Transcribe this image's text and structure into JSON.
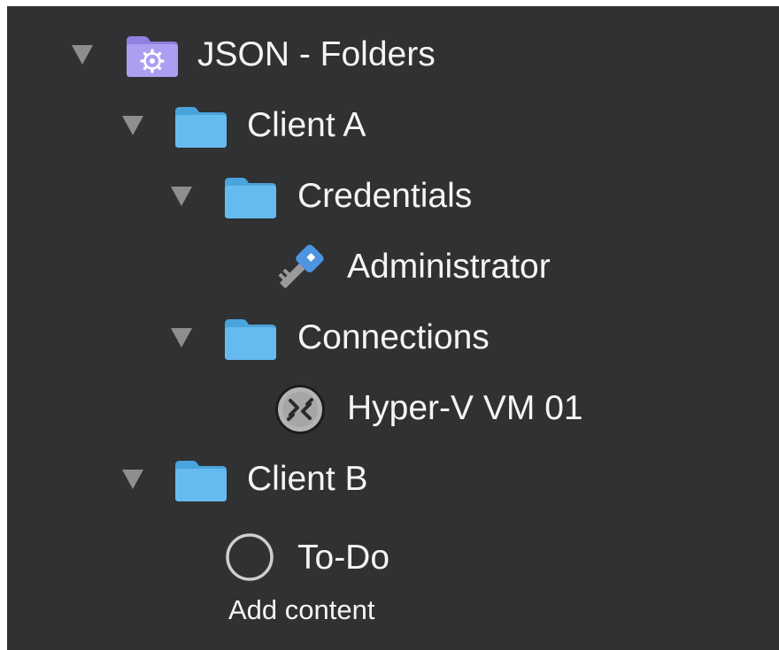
{
  "tree": {
    "root": {
      "label": "JSON - Folders",
      "icon": "gear-folder-icon",
      "expanded": true
    },
    "client_a": {
      "label": "Client A",
      "icon": "folder-icon",
      "expanded": true
    },
    "credentials": {
      "label": "Credentials",
      "icon": "folder-icon",
      "expanded": true
    },
    "administrator": {
      "label": "Administrator",
      "icon": "key-icon"
    },
    "connections": {
      "label": "Connections",
      "icon": "folder-icon",
      "expanded": true
    },
    "hyperv": {
      "label": "Hyper-V VM 01",
      "icon": "remote-desktop-icon"
    },
    "client_b": {
      "label": "Client B",
      "icon": "folder-icon",
      "expanded": true
    },
    "todo": {
      "label": "To-Do",
      "icon": "circle-checkbox-icon"
    }
  },
  "footer": {
    "add_content_label": "Add content"
  },
  "colors": {
    "panel_background": "#303132",
    "text": "#f4f4f4",
    "folder_blue": "#5fb6ea",
    "gear_folder_purple": "#a89bf0",
    "disclosure": "#8e8e90"
  }
}
